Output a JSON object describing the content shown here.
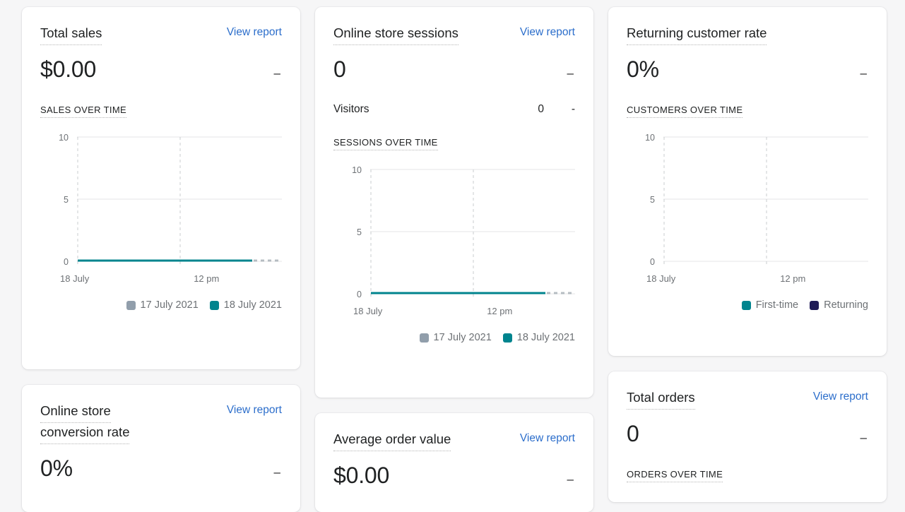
{
  "theme": {
    "background": "#f6f6f7",
    "card_background": "#ffffff",
    "link_color": "#2c6ecb",
    "text_color": "#202223",
    "muted_text": "#6d7175",
    "teal": "#00848e",
    "gray_series": "#919eab",
    "navy": "#1f1b57",
    "gridline": "#e4e5e7"
  },
  "cards": {
    "total_sales": {
      "title_lines": [
        "Total sales"
      ],
      "view_report": "View report",
      "value": "$0.00",
      "delta": "–",
      "section_label": "SALES OVER TIME",
      "legend": [
        {
          "label": "17 July 2021",
          "color": "#919eab"
        },
        {
          "label": "18 July 2021",
          "color": "#00848e"
        }
      ]
    },
    "online_store_sessions": {
      "title_lines": [
        "Online store sessions"
      ],
      "view_report": "View report",
      "value": "0",
      "delta": "–",
      "sub_label": "Visitors",
      "sub_value": "0",
      "sub_delta": "-",
      "section_label": "SESSIONS OVER TIME",
      "legend": [
        {
          "label": "17 July 2021",
          "color": "#919eab"
        },
        {
          "label": "18 July 2021",
          "color": "#00848e"
        }
      ]
    },
    "returning_customer_rate": {
      "title_lines": [
        "Returning customer rate"
      ],
      "value": "0%",
      "delta": "–",
      "section_label": "CUSTOMERS OVER TIME",
      "legend": [
        {
          "label": "First-time",
          "color": "#00848e"
        },
        {
          "label": "Returning",
          "color": "#1f1b57"
        }
      ]
    },
    "online_store_conversion_rate": {
      "title_lines": [
        "Online store",
        "conversion rate"
      ],
      "view_report": "View report",
      "value": "0%",
      "delta": "–"
    },
    "average_order_value": {
      "title_lines": [
        "Average order value"
      ],
      "view_report": "View report",
      "value": "$0.00",
      "delta": "–"
    },
    "total_orders": {
      "title_lines": [
        "Total orders"
      ],
      "view_report": "View report",
      "value": "0",
      "delta": "–",
      "section_label": "ORDERS OVER TIME"
    }
  },
  "chart_data": [
    {
      "id": "sales_over_time",
      "type": "line",
      "title": "SALES OVER TIME",
      "xlabel": "",
      "ylabel": "",
      "ylim": [
        0,
        10
      ],
      "yticks": [
        0,
        5,
        10
      ],
      "ytick_labels": [
        "0",
        "5",
        "10"
      ],
      "xticks": [
        "18 July",
        "12 pm"
      ],
      "grid": true,
      "legend_position": "bottom-right",
      "series": [
        {
          "name": "17 July 2021",
          "color": "#919eab",
          "values": [
            0,
            0,
            0,
            0,
            0,
            0,
            0,
            0,
            0
          ],
          "style": "solid"
        },
        {
          "name": "18 July 2021",
          "color": "#00848e",
          "values": [
            0,
            0,
            0,
            0,
            0,
            0,
            0
          ],
          "style": "solid",
          "projected_values": [
            0,
            0,
            0
          ]
        }
      ]
    },
    {
      "id": "sessions_over_time",
      "type": "line",
      "title": "SESSIONS OVER TIME",
      "xlabel": "",
      "ylabel": "",
      "ylim": [
        0,
        10
      ],
      "yticks": [
        0,
        5,
        10
      ],
      "ytick_labels": [
        "0",
        "5",
        "10"
      ],
      "xticks": [
        "18 July",
        "12 pm"
      ],
      "grid": true,
      "legend_position": "bottom-right",
      "series": [
        {
          "name": "17 July 2021",
          "color": "#919eab",
          "values": [
            0,
            0,
            0,
            0,
            0,
            0,
            0,
            0,
            0
          ],
          "style": "solid"
        },
        {
          "name": "18 July 2021",
          "color": "#00848e",
          "values": [
            0,
            0,
            0,
            0,
            0,
            0,
            0
          ],
          "style": "solid",
          "projected_values": [
            0,
            0,
            0
          ]
        }
      ]
    },
    {
      "id": "customers_over_time",
      "type": "line",
      "title": "CUSTOMERS OVER TIME",
      "xlabel": "",
      "ylabel": "",
      "ylim": [
        0,
        10
      ],
      "yticks": [
        0,
        5,
        10
      ],
      "ytick_labels": [
        "0",
        "5",
        "10"
      ],
      "xticks": [
        "18 July",
        "12 pm"
      ],
      "grid": true,
      "legend_position": "bottom-right",
      "series": [
        {
          "name": "First-time",
          "color": "#00848e",
          "values": []
        },
        {
          "name": "Returning",
          "color": "#1f1b57",
          "values": []
        }
      ]
    }
  ]
}
